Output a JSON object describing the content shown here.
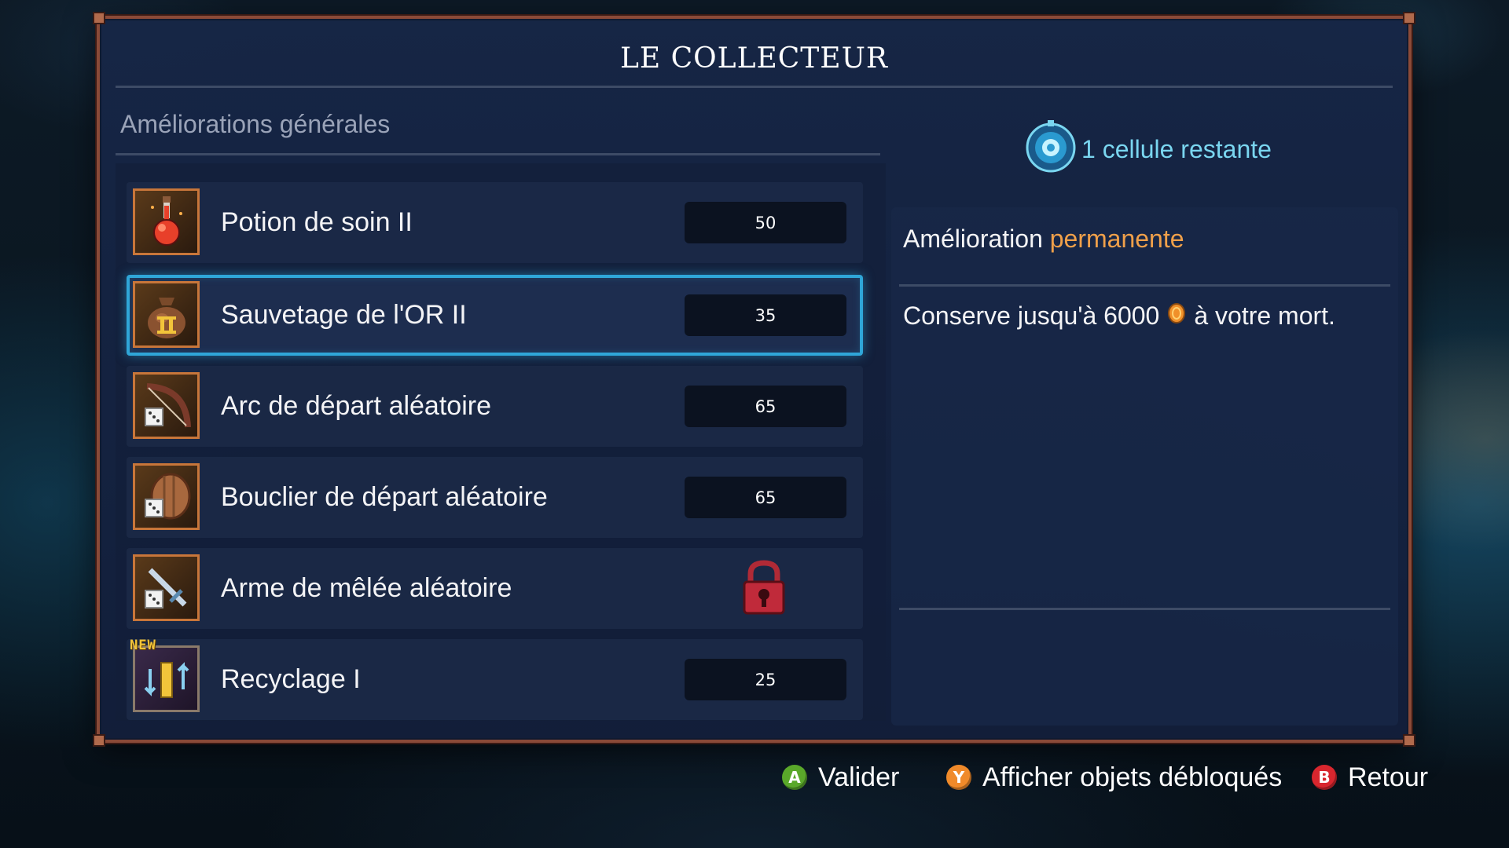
{
  "panel": {
    "title": "LE COLLECTEUR",
    "section_label": "Améliorations générales"
  },
  "upgrades": [
    {
      "name": "Potion de soin II",
      "cost": "50",
      "icon": "health-potion-icon",
      "locked": false
    },
    {
      "name": "Sauvetage de l'OR II",
      "cost": "35",
      "icon": "gold-bag-icon",
      "locked": false,
      "selected": true
    },
    {
      "name": "Arc de départ aléatoire",
      "cost": "65",
      "icon": "bow-dice-icon",
      "locked": false
    },
    {
      "name": "Bouclier de départ aléatoire",
      "cost": "65",
      "icon": "shield-dice-icon",
      "locked": false
    },
    {
      "name": "Arme de mêlée aléatoire",
      "cost": "",
      "icon": "sword-dice-icon",
      "locked": true
    },
    {
      "name": "Recyclage I",
      "cost": "25",
      "icon": "recycle-icon",
      "locked": false,
      "badge": "NEW"
    }
  ],
  "cells": {
    "text": "1 cellule restante",
    "icon": "cell-icon"
  },
  "detail": {
    "heading_prefix": "Amélioration",
    "heading_accent": "permanente",
    "desc_prefix": "Conserve jusqu'à 6000",
    "desc_suffix": "à votre mort.",
    "currency_icon": "gold-coin-icon"
  },
  "footer": {
    "validate_key": "A",
    "validate_label": "Valider",
    "unlocked_key": "Y",
    "unlocked_label": "Afficher objets débloqués",
    "back_key": "B",
    "back_label": "Retour"
  },
  "colors": {
    "frame": "#8a4a38",
    "selection": "#2fa6d8",
    "accent_orange": "#f0a04a",
    "cell_cyan": "#7ad6f0",
    "button_a": "#5aa82a",
    "button_y": "#f08a2a",
    "button_b": "#d8262e"
  }
}
